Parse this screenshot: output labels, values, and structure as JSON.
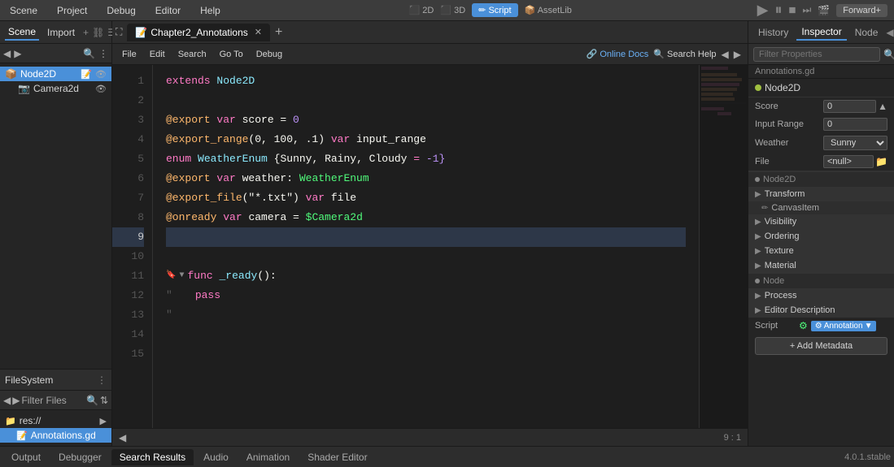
{
  "menu": {
    "scene": "Scene",
    "project": "Project",
    "debug": "Debug",
    "editor": "Editor",
    "help": "Help"
  },
  "toolbar": {
    "btn2d": "2D",
    "btn3d": "3D",
    "script": "Script",
    "assetlib": "AssetLib",
    "forward": "Forward+"
  },
  "scene_panel": {
    "tab_scene": "Scene",
    "tab_import": "Import",
    "node2d": "Node2D",
    "camera2d": "Camera2d"
  },
  "editor": {
    "file_menu": "File",
    "edit_menu": "Edit",
    "search_menu": "Search",
    "goto_menu": "Go To",
    "debug_menu": "Debug",
    "online_docs": "Online Docs",
    "search_help": "Search Help",
    "tab_name": "Chapter2_Annotations",
    "status_line": "9",
    "status_col": "1",
    "minimap_visible": true
  },
  "code": {
    "lines": [
      {
        "num": 1,
        "content": "extends Node2D",
        "tokens": [
          {
            "text": "extends",
            "cls": "kw-pink"
          },
          {
            "text": " ",
            "cls": ""
          },
          {
            "text": "Node2D",
            "cls": "kw-blue"
          }
        ]
      },
      {
        "num": 2,
        "content": "",
        "tokens": []
      },
      {
        "num": 3,
        "content": "@export var score = 0",
        "tokens": [
          {
            "text": "@export",
            "cls": "kw-orange"
          },
          {
            "text": " ",
            "cls": ""
          },
          {
            "text": "var",
            "cls": "kw-pink"
          },
          {
            "text": " score ",
            "cls": "kw-white"
          },
          {
            "text": "=",
            "cls": "kw-pink"
          },
          {
            "text": " 0",
            "cls": "kw-purple"
          }
        ]
      },
      {
        "num": 4,
        "content": "@export_range(0, 100, .1) var input_range",
        "tokens": [
          {
            "text": "@export_range",
            "cls": "kw-orange"
          },
          {
            "text": "(0, 100, .1) ",
            "cls": "kw-white"
          },
          {
            "text": "var",
            "cls": "kw-pink"
          },
          {
            "text": " input_range",
            "cls": "kw-white"
          }
        ]
      },
      {
        "num": 5,
        "content": "enum WeatherEnum {Sunny, Rainy, Cloudy = -1}",
        "tokens": [
          {
            "text": "enum",
            "cls": "kw-pink"
          },
          {
            "text": " WeatherEnum ",
            "cls": "kw-blue"
          },
          {
            "text": "{Sunny, Rainy, Cloudy ",
            "cls": "kw-white"
          },
          {
            "text": "=",
            "cls": "kw-pink"
          },
          {
            "text": " -1}",
            "cls": "kw-purple"
          }
        ]
      },
      {
        "num": 6,
        "content": "@export var weather: WeatherEnum",
        "tokens": [
          {
            "text": "@export",
            "cls": "kw-orange"
          },
          {
            "text": " ",
            "cls": ""
          },
          {
            "text": "var",
            "cls": "kw-pink"
          },
          {
            "text": " weather: ",
            "cls": "kw-white"
          },
          {
            "text": "WeatherEnum",
            "cls": "kw-cyan"
          }
        ]
      },
      {
        "num": 7,
        "content": "@export_file(\"*.txt\") var file",
        "tokens": [
          {
            "text": "@export_file",
            "cls": "kw-orange"
          },
          {
            "text": "(\"*.txt\") ",
            "cls": "kw-white"
          },
          {
            "text": "var",
            "cls": "kw-pink"
          },
          {
            "text": " file",
            "cls": "kw-white"
          }
        ]
      },
      {
        "num": 8,
        "content": "@onready var camera = $Camera2d",
        "tokens": [
          {
            "text": "@onready",
            "cls": "kw-orange"
          },
          {
            "text": " ",
            "cls": ""
          },
          {
            "text": "var",
            "cls": "kw-pink"
          },
          {
            "text": " camera ",
            "cls": "kw-white"
          },
          {
            "text": "=",
            "cls": "kw-pink"
          },
          {
            "text": " $Camera2d",
            "cls": "kw-dollar"
          }
        ]
      },
      {
        "num": 9,
        "content": "",
        "tokens": [],
        "active": true
      },
      {
        "num": 10,
        "content": "",
        "tokens": []
      },
      {
        "num": 11,
        "content": "func _ready():",
        "tokens": [
          {
            "text": "func",
            "cls": "kw-pink"
          },
          {
            "text": " ",
            "cls": ""
          },
          {
            "text": "_ready",
            "cls": "kw-teal"
          },
          {
            "text": "():",
            "cls": "kw-white"
          }
        ],
        "marker": true,
        "fold": true
      },
      {
        "num": 12,
        "content": "    pass",
        "tokens": [
          {
            "text": "    ",
            "cls": ""
          },
          {
            "text": "pass",
            "cls": "kw-pink"
          }
        ],
        "indent": true
      },
      {
        "num": 13,
        "content": "",
        "tokens": [],
        "indent": true
      },
      {
        "num": 14,
        "content": "",
        "tokens": []
      },
      {
        "num": 15,
        "content": "",
        "tokens": []
      }
    ]
  },
  "inspector": {
    "tab_history": "History",
    "tab_inspector": "Inspector",
    "tab_node": "Node",
    "filter_placeholder": "Filter Properties",
    "file_label": "Annotations.gd",
    "node_path": "Node2D",
    "sections": {
      "score_label": "Score",
      "score_value": "0",
      "input_range_label": "Input Range",
      "input_range_value": "0",
      "weather_label": "Weather",
      "weather_value": "Sunny",
      "file_prop_label": "File",
      "file_prop_value": "<null>",
      "node2d_label": "Node2D"
    },
    "transform": "Transform",
    "canvas_item": "CanvasItem",
    "visibility": "Visibility",
    "ordering": "Ordering",
    "texture": "Texture",
    "material": "Material",
    "node_label": "Node",
    "process": "Process",
    "editor_description": "Editor Description",
    "script_label": "Script",
    "annotation_label": "Annotation",
    "add_metadata": "+ Add Metadata"
  },
  "filesystem": {
    "header": "FileSystem",
    "res_root": "res://",
    "res_item": "res://",
    "annotations_file": "Annotations.gd"
  },
  "bottom_tabs": {
    "output": "Output",
    "debugger": "Debugger",
    "search_results": "Search Results",
    "audio": "Audio",
    "animation": "Animation",
    "shader_editor": "Shader Editor"
  },
  "version": "4.0.1.stable"
}
